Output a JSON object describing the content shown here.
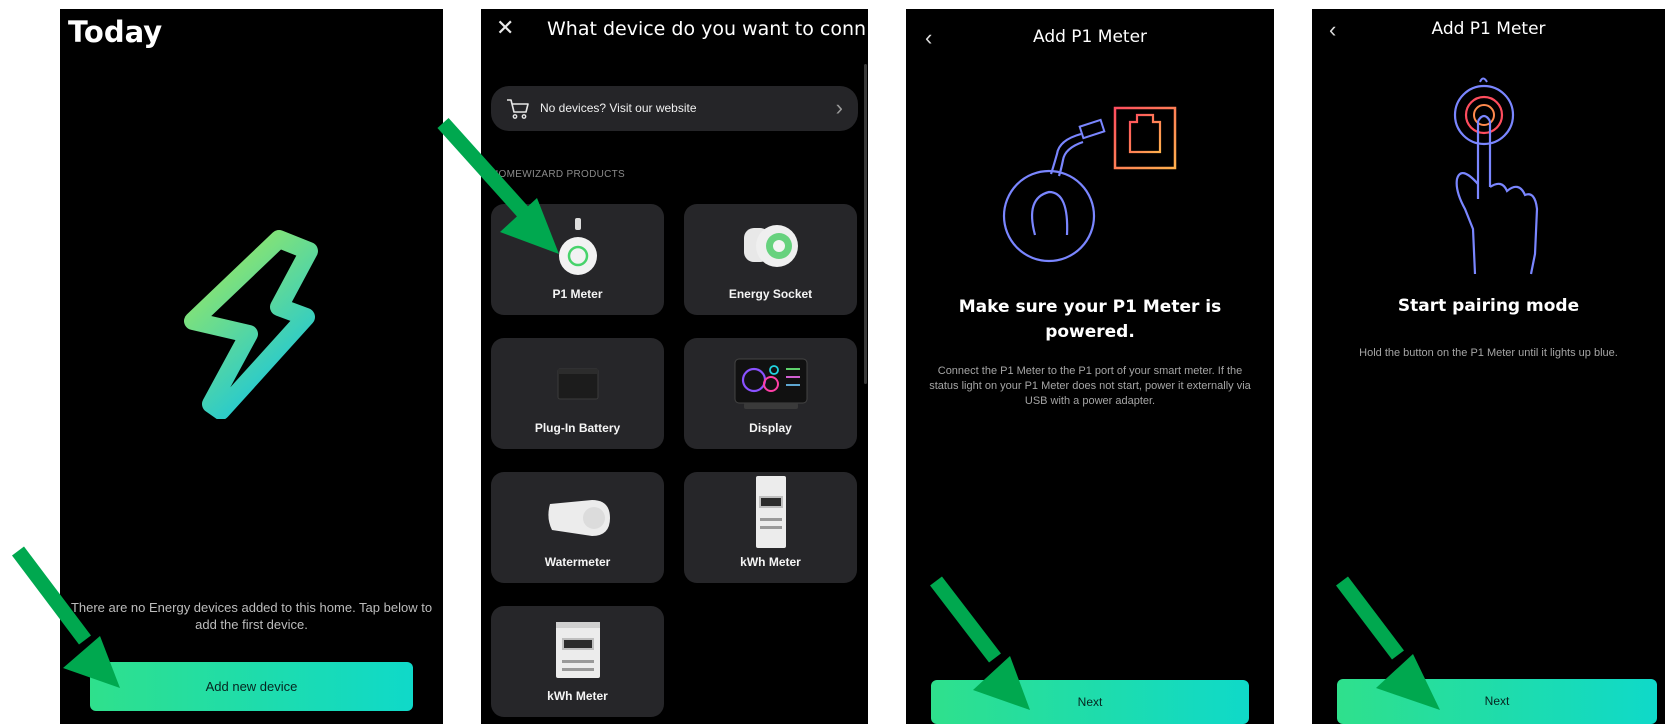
{
  "screen1": {
    "title": "Today",
    "empty_message": "There are no Energy devices added to this home. Tap below to add the first device.",
    "add_button": "Add new device"
  },
  "screen2": {
    "close_icon": "close-icon",
    "title": "What device do you want to conn…",
    "website_link": "No devices? Visit our website",
    "section_header": "HOMEWIZARD PRODUCTS",
    "devices": [
      {
        "label": "P1 Meter"
      },
      {
        "label": "Energy Socket"
      },
      {
        "label": "Plug-In Battery"
      },
      {
        "label": "Display"
      },
      {
        "label": "Watermeter"
      },
      {
        "label": "kWh Meter"
      },
      {
        "label": "kWh Meter"
      }
    ]
  },
  "screen3": {
    "title": "Add P1 Meter",
    "heading": "Make sure your P1 Meter is powered.",
    "body": "Connect the P1 Meter to the P1 port of your smart meter. If the status light on your P1 Meter does not start, power it externally via USB with a power adapter.",
    "next_button": "Next"
  },
  "screen4": {
    "title": "Add P1 Meter",
    "heading": "Start pairing mode",
    "body": "Hold the button on the P1 Meter until it lights up blue.",
    "next_button": "Next"
  },
  "colors": {
    "button_gradient_start": "#2fe08c",
    "button_gradient_end": "#0fd9c9",
    "arrow": "#00a84f",
    "tile_bg": "#262629"
  }
}
